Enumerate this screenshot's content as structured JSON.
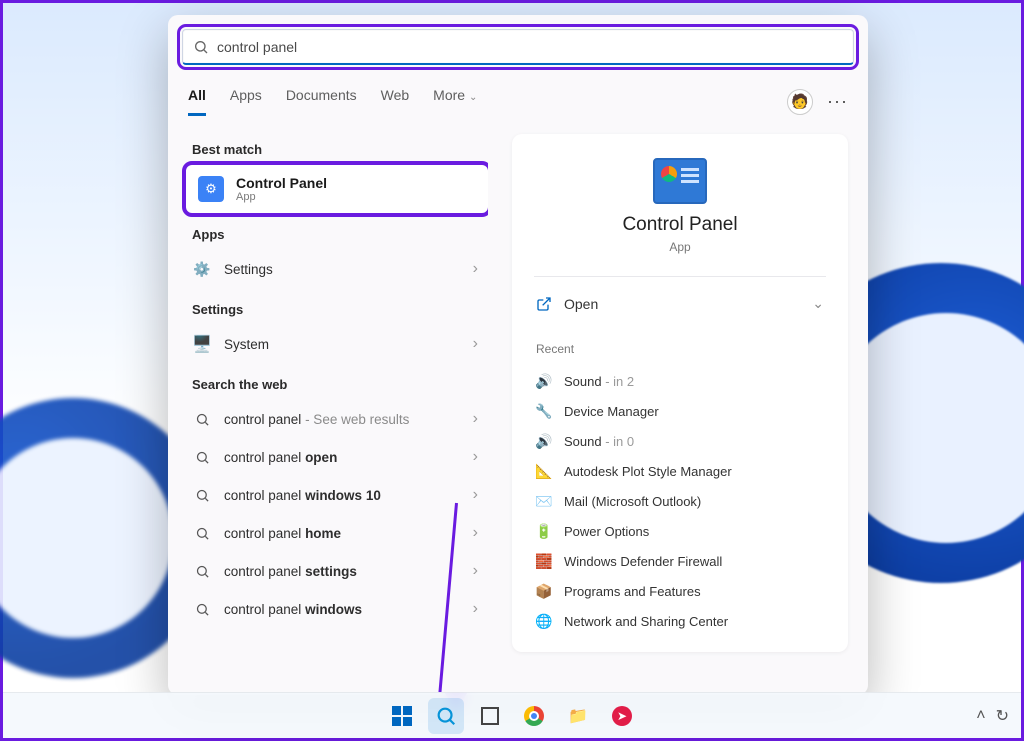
{
  "search": {
    "query": "control panel"
  },
  "tabs": {
    "items": [
      "All",
      "Apps",
      "Documents",
      "Web",
      "More"
    ],
    "active": 0
  },
  "left": {
    "best_match_header": "Best match",
    "best_match": {
      "title": "Control Panel",
      "subtitle": "App"
    },
    "apps_header": "Apps",
    "apps": [
      {
        "label": "Settings"
      }
    ],
    "settings_header": "Settings",
    "settings": [
      {
        "label": "System"
      }
    ],
    "web_header": "Search the web",
    "web": [
      {
        "prefix": "control panel",
        "bold": "",
        "hint": "See web results"
      },
      {
        "prefix": "control panel ",
        "bold": "open",
        "hint": ""
      },
      {
        "prefix": "control panel ",
        "bold": "windows 10",
        "hint": ""
      },
      {
        "prefix": "control panel ",
        "bold": "home",
        "hint": ""
      },
      {
        "prefix": "control panel ",
        "bold": "settings",
        "hint": ""
      },
      {
        "prefix": "control panel ",
        "bold": "windows",
        "hint": ""
      }
    ]
  },
  "detail": {
    "title": "Control Panel",
    "subtitle": "App",
    "open_label": "Open",
    "recent_header": "Recent",
    "recent": [
      {
        "label": "Sound",
        "suffix": " - in 2"
      },
      {
        "label": "Device Manager",
        "suffix": ""
      },
      {
        "label": "Sound",
        "suffix": " - in 0"
      },
      {
        "label": "Autodesk Plot Style Manager",
        "suffix": ""
      },
      {
        "label": "Mail (Microsoft Outlook)",
        "suffix": ""
      },
      {
        "label": "Power Options",
        "suffix": ""
      },
      {
        "label": "Windows Defender Firewall",
        "suffix": ""
      },
      {
        "label": "Programs and Features",
        "suffix": ""
      },
      {
        "label": "Network and Sharing Center",
        "suffix": ""
      }
    ]
  }
}
